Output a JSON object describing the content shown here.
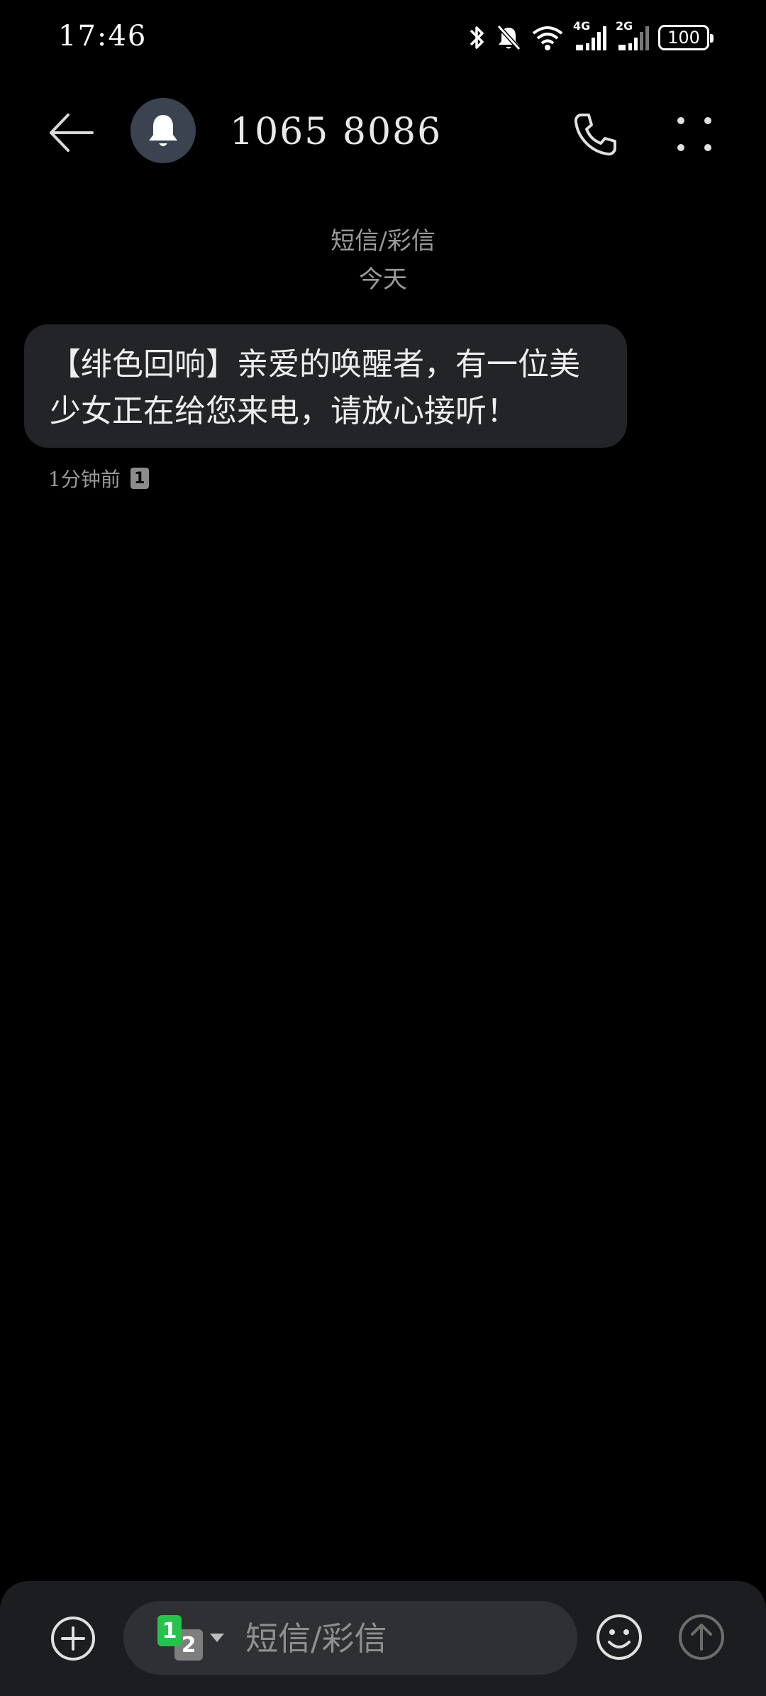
{
  "status_bar": {
    "time": "17:46",
    "network_1": "4G",
    "network_2": "2G",
    "battery": "100",
    "icons": [
      "bluetooth-icon",
      "bell-muted-icon",
      "wifi-icon",
      "signal-icon",
      "signal-icon"
    ]
  },
  "header": {
    "title": "1065 8086",
    "avatar_icon": "bell-icon",
    "back_icon": "arrow-left-icon",
    "call_icon": "phone-icon",
    "more_icon": "more-dots-icon"
  },
  "conversation": {
    "channel": "短信/彩信",
    "date": "今天",
    "messages": [
      {
        "text": "【绯色回响】亲爱的唤醒者，有一位美少女正在给您来电，请放心接听！",
        "time": "1分钟前",
        "sim": "1"
      }
    ]
  },
  "compose": {
    "placeholder": "短信/彩信",
    "sim_primary": "1",
    "sim_secondary": "2",
    "add_icon": "plus-circle-icon",
    "emoji_icon": "smiley-icon",
    "send_icon": "send-arrow-icon"
  },
  "colors": {
    "background": "#000000",
    "bubble": "#232427",
    "compose_bar": "#1c1d20",
    "sim_green": "#26c24b"
  }
}
